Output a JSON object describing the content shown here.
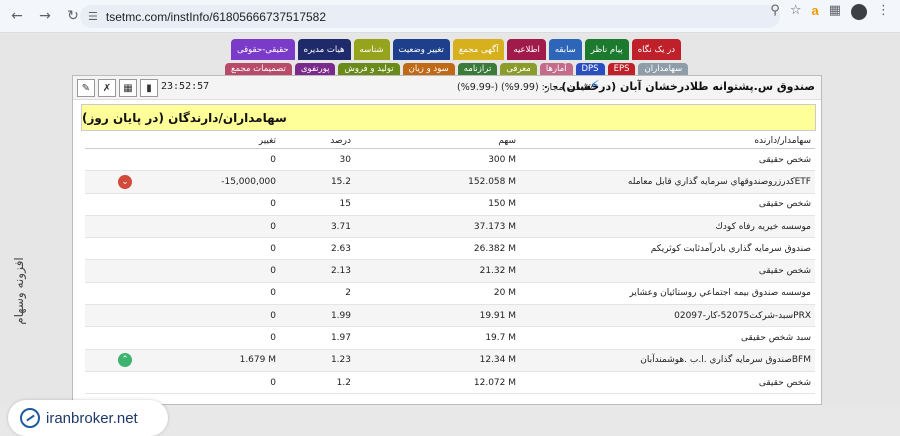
{
  "browser": {
    "url": "tsetmc.com/instInfo/61805666737517582",
    "back_icon": "arrow-left-icon",
    "forward_icon": "arrow-right-icon",
    "reload_icon": "reload-icon"
  },
  "menu_row1": [
    {
      "label": "در یک نگاه",
      "color": "#c0202a"
    },
    {
      "label": "پیام ناظر",
      "color": "#1b7a2e"
    },
    {
      "label": "سابقه",
      "color": "#2d66b8"
    },
    {
      "label": "اطلاعیه",
      "color": "#a01a4a"
    },
    {
      "label": "آگهی مجمع",
      "color": "#d7b01e"
    },
    {
      "label": "تغییر وضعیت",
      "color": "#1d3f8c"
    },
    {
      "label": "شناسه",
      "color": "#96a31c"
    },
    {
      "label": "هیات مدیره",
      "color": "#1f2a6a"
    },
    {
      "label": "حقیقی-حقوقی",
      "color": "#7a3cc8"
    }
  ],
  "menu_row2": [
    {
      "label": "سهامداران",
      "color": "#8f9da8"
    },
    {
      "label": "EPS",
      "color": "#c0202a"
    },
    {
      "label": "DPS",
      "color": "#2a4ec0"
    },
    {
      "label": "آمارها",
      "color": "#c46a8a"
    },
    {
      "label": "معرفی",
      "color": "#8c9c2a"
    },
    {
      "label": "ترازنامه",
      "color": "#3a7a3a"
    },
    {
      "label": "سود و زیان",
      "color": "#c06a18"
    },
    {
      "label": "تولید و فروش",
      "color": "#6a8a1a"
    },
    {
      "label": "پورتفوی",
      "color": "#7a2a8c"
    },
    {
      "label": "تصمیمات مجمع",
      "color": "#b84a6a"
    }
  ],
  "side_label": "افزونه وسهام",
  "panel": {
    "time": "23:52:57",
    "title": "صندوق س.پشتوانه طلادرخشان آبان (درخشان) - ۰",
    "price_range": "٪قیمت مجاز: (9.99%) (-9.99%)"
  },
  "section_title": "سهامداران/دارندگان (در پایان روز)",
  "table": {
    "headers": {
      "holder": "سهامدار/دارنده",
      "share": "سهم",
      "percent": "درصد",
      "change": "تغییر"
    },
    "rows": [
      {
        "holder": "شخص حقیقی",
        "share": "300 M",
        "percent": "30",
        "change": "0",
        "arrow": ""
      },
      {
        "holder": "ETFکدرزروصندوقهاي سرمايه گذاري قابل معامله",
        "share": "152.058 M",
        "percent": "15.2",
        "change": "-15,000,000",
        "arrow": "down"
      },
      {
        "holder": "شخص حقیقی",
        "share": "150 M",
        "percent": "15",
        "change": "0",
        "arrow": ""
      },
      {
        "holder": "موسسه خيريه رفاه كودك",
        "share": "37.173 M",
        "percent": "3.71",
        "change": "0",
        "arrow": ""
      },
      {
        "holder": "صندوق سرمايه گذاري بادرآمدثابت كوثريكم",
        "share": "26.382 M",
        "percent": "2.63",
        "change": "0",
        "arrow": ""
      },
      {
        "holder": "شخص حقیقی",
        "share": "21.32 M",
        "percent": "2.13",
        "change": "0",
        "arrow": ""
      },
      {
        "holder": "موسسه صندوق بيمه اجتماعي روستائيان وعشاير",
        "share": "20 M",
        "percent": "2",
        "change": "0",
        "arrow": ""
      },
      {
        "holder": "PRXسبد-شرکت52075-کار-02097",
        "share": "19.91 M",
        "percent": "1.99",
        "change": "0",
        "arrow": ""
      },
      {
        "holder": "سبد شخص حقیقی",
        "share": "19.7 M",
        "percent": "1.97",
        "change": "0",
        "arrow": ""
      },
      {
        "holder": "BFMصندوق سرمايه گذاري .ا.ب .هوشمندآبان",
        "share": "12.34 M",
        "percent": "1.23",
        "change": "1.679 M",
        "arrow": "up"
      },
      {
        "holder": "شخص حقیقی",
        "share": "12.072 M",
        "percent": "1.2",
        "change": "0",
        "arrow": ""
      }
    ]
  },
  "watermark": "iranbroker.net"
}
